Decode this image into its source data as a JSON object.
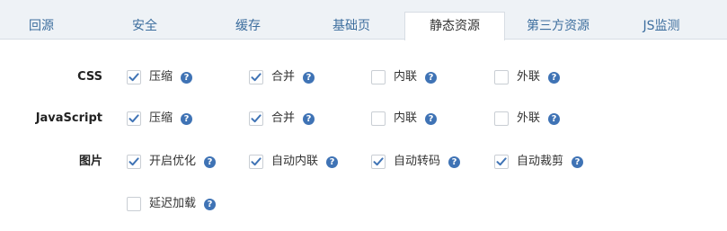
{
  "tabs": [
    {
      "label": "回源"
    },
    {
      "label": "安全"
    },
    {
      "label": "缓存"
    },
    {
      "label": "基础页"
    },
    {
      "label": "静态资源",
      "active": true
    },
    {
      "label": "第三方资源"
    },
    {
      "label": "JS监测"
    }
  ],
  "help_glyph": "?",
  "check_color": "#3f73b5",
  "rows": [
    {
      "label": "CSS",
      "options": [
        {
          "label": "压缩",
          "checked": true
        },
        {
          "label": "合并",
          "checked": true
        },
        {
          "label": "内联",
          "checked": false
        },
        {
          "label": "外联",
          "checked": false
        }
      ]
    },
    {
      "label": "JavaScript",
      "options": [
        {
          "label": "压缩",
          "checked": true
        },
        {
          "label": "合并",
          "checked": true
        },
        {
          "label": "内联",
          "checked": false
        },
        {
          "label": "外联",
          "checked": false
        }
      ]
    },
    {
      "label": "图片",
      "options": [
        {
          "label": "开启优化",
          "checked": true
        },
        {
          "label": "自动内联",
          "checked": true
        },
        {
          "label": "自动转码",
          "checked": true
        },
        {
          "label": "自动裁剪",
          "checked": true
        },
        {
          "label": "延迟加载",
          "checked": false
        }
      ]
    }
  ]
}
